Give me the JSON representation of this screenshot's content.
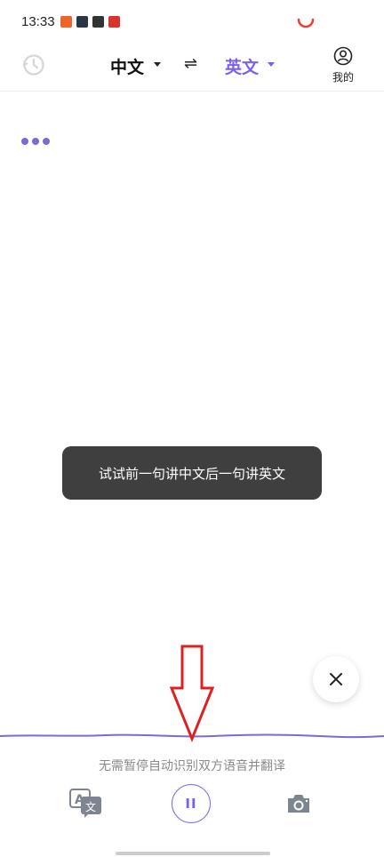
{
  "status_bar": {
    "time": "13:33",
    "notification_icons": [
      "app-icon-orange",
      "app-icon-dark-play",
      "app-icon-dark-loop",
      "app-icon-red"
    ]
  },
  "header": {
    "source_language": "中文",
    "swap_glyph": "⇌",
    "target_language": "英文",
    "profile_label": "我的"
  },
  "toast": {
    "message": "试试前一句讲中文后一句讲英文"
  },
  "footer": {
    "hint": "无需暂停自动识别双方语音并翻译",
    "pause_glyph": "II"
  },
  "colors": {
    "accent": "#7a5ff0",
    "toast_bg": "#3f3f3f",
    "wave": "#7a6cd8",
    "annotation_arrow": "#e02020"
  }
}
